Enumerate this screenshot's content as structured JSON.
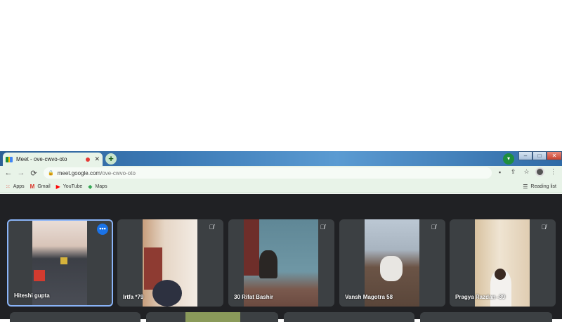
{
  "browser": {
    "tab": {
      "title": "Meet - ove-cwvo-oto",
      "close": "✕"
    },
    "new_tab": "+",
    "window_controls": {
      "minimize": "–",
      "maximize": "□",
      "close": "✕"
    },
    "nav": {
      "back": "←",
      "forward": "→",
      "reload": "⟳"
    },
    "url": {
      "host": "meet.google.com",
      "path": "/ove-cwvo-oto"
    },
    "bookmarks": [
      {
        "label": "Apps",
        "icon": "apps-grid-icon"
      },
      {
        "label": "Gmail",
        "icon": "gmail-icon"
      },
      {
        "label": "YouTube",
        "icon": "youtube-icon"
      },
      {
        "label": "Maps",
        "icon": "maps-icon"
      }
    ],
    "reading_list": "Reading list"
  },
  "meet": {
    "participants": [
      {
        "name": "Hiteshi gupta",
        "active": true
      },
      {
        "name": "Irtfa *79",
        "active": false
      },
      {
        "name": "30 Rifat Bashir",
        "active": false
      },
      {
        "name": "Vansh Magotra 58",
        "active": false
      },
      {
        "name": "Pragya Razdan -39",
        "active": false
      }
    ],
    "colors": {
      "background": "#202124",
      "tile": "#3c4043",
      "active_border": "#8ab4f8",
      "accent": "#1a73e8"
    }
  }
}
